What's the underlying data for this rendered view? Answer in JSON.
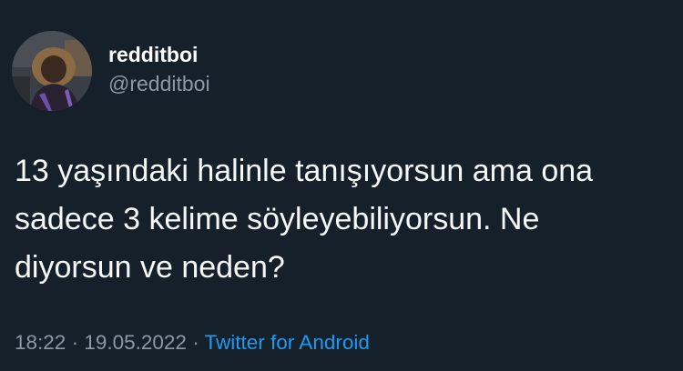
{
  "user": {
    "display_name": "redditboi",
    "handle": "@redditboi"
  },
  "tweet": {
    "lines": [
      "13 yaşındaki halinle tanışıyorsun ama ona",
      "sadece 3 kelime söyleyebiliyorsun. Ne",
      "diyorsun ve neden?"
    ]
  },
  "meta": {
    "time": "18:22",
    "separator": " · ",
    "date": "19.05.2022",
    "source": "Twitter for Android"
  },
  "colors": {
    "background": "#15202b",
    "text": "#f7f9f9",
    "secondary": "#8b98a5",
    "link": "#1d9bf0"
  }
}
